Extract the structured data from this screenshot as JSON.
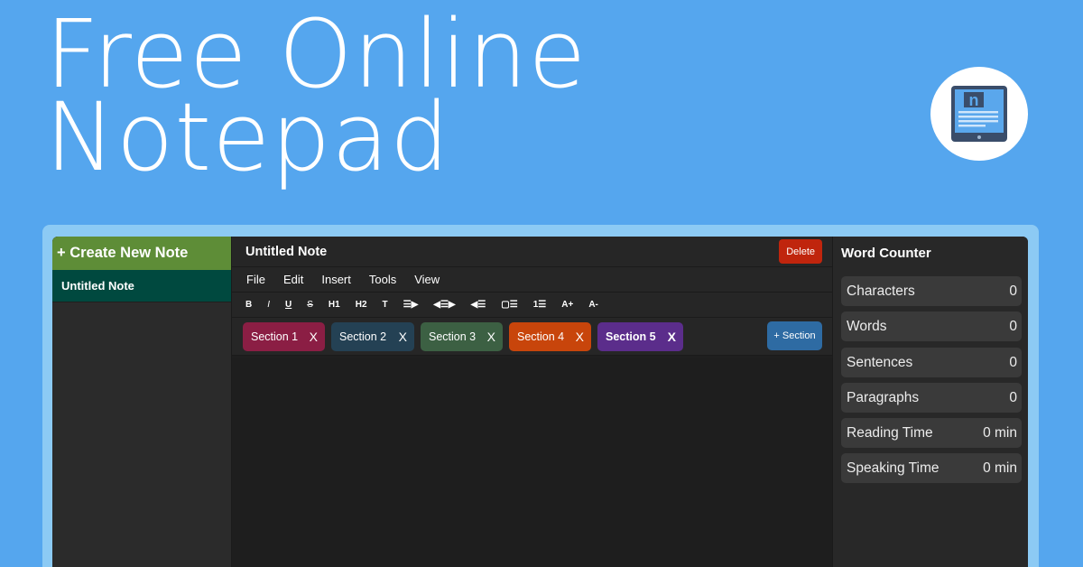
{
  "hero": {
    "line1": "Free Online",
    "line2": "Notepad"
  },
  "logo": {
    "icon": "notepad-tablet-icon",
    "letter": "n"
  },
  "sidebar": {
    "create_label": "+ Create New Note",
    "notes": [
      {
        "label": "Untitled Note"
      }
    ]
  },
  "editor": {
    "title": "Untitled Note",
    "delete_label": "Delete",
    "menu": [
      "File",
      "Edit",
      "Insert",
      "Tools",
      "View"
    ],
    "toolbar": [
      {
        "label": "B",
        "icon": "bold-icon"
      },
      {
        "label": "I",
        "icon": "italic-icon"
      },
      {
        "label": "U",
        "icon": "underline-icon"
      },
      {
        "label": "S",
        "icon": "strikethrough-icon"
      },
      {
        "label": "H1",
        "icon": "heading1-icon"
      },
      {
        "label": "H2",
        "icon": "heading2-icon"
      },
      {
        "label": "T",
        "icon": "text-icon"
      },
      {
        "label": "☰▶",
        "icon": "align-right-icon"
      },
      {
        "label": "◀☰▶",
        "icon": "align-center-icon"
      },
      {
        "label": "◀☰",
        "icon": "align-left-icon"
      },
      {
        "label": "▢☰",
        "icon": "bullet-list-icon"
      },
      {
        "label": "1☰",
        "icon": "numbered-list-icon"
      },
      {
        "label": "A+",
        "icon": "font-increase-icon"
      },
      {
        "label": "A-",
        "icon": "font-decrease-icon"
      }
    ],
    "sections": [
      {
        "label": "Section 1",
        "close": "X",
        "color": "#8b1e44"
      },
      {
        "label": "Section 2",
        "close": "X",
        "color": "#244154"
      },
      {
        "label": "Section 3",
        "close": "X",
        "color": "#3c6043"
      },
      {
        "label": "Section 4",
        "close": "X",
        "color": "#c8450b"
      },
      {
        "label": "Section 5",
        "close": "X",
        "color": "#5b2d8b",
        "active": true
      }
    ],
    "add_section_label": "+ Section"
  },
  "counter": {
    "title": "Word Counter",
    "stats": [
      {
        "label": "Characters",
        "value": "0"
      },
      {
        "label": "Words",
        "value": "0"
      },
      {
        "label": "Sentences",
        "value": "0"
      },
      {
        "label": "Paragraphs",
        "value": "0"
      },
      {
        "label": "Reading Time",
        "value": "0 min"
      },
      {
        "label": "Speaking Time",
        "value": "0 min"
      }
    ]
  },
  "colors": {
    "background": "#55a6ee",
    "create_button": "#5e8d37",
    "active_note": "#00493f",
    "delete_button": "#c0250d",
    "add_section_button": "#2e6ba3"
  }
}
